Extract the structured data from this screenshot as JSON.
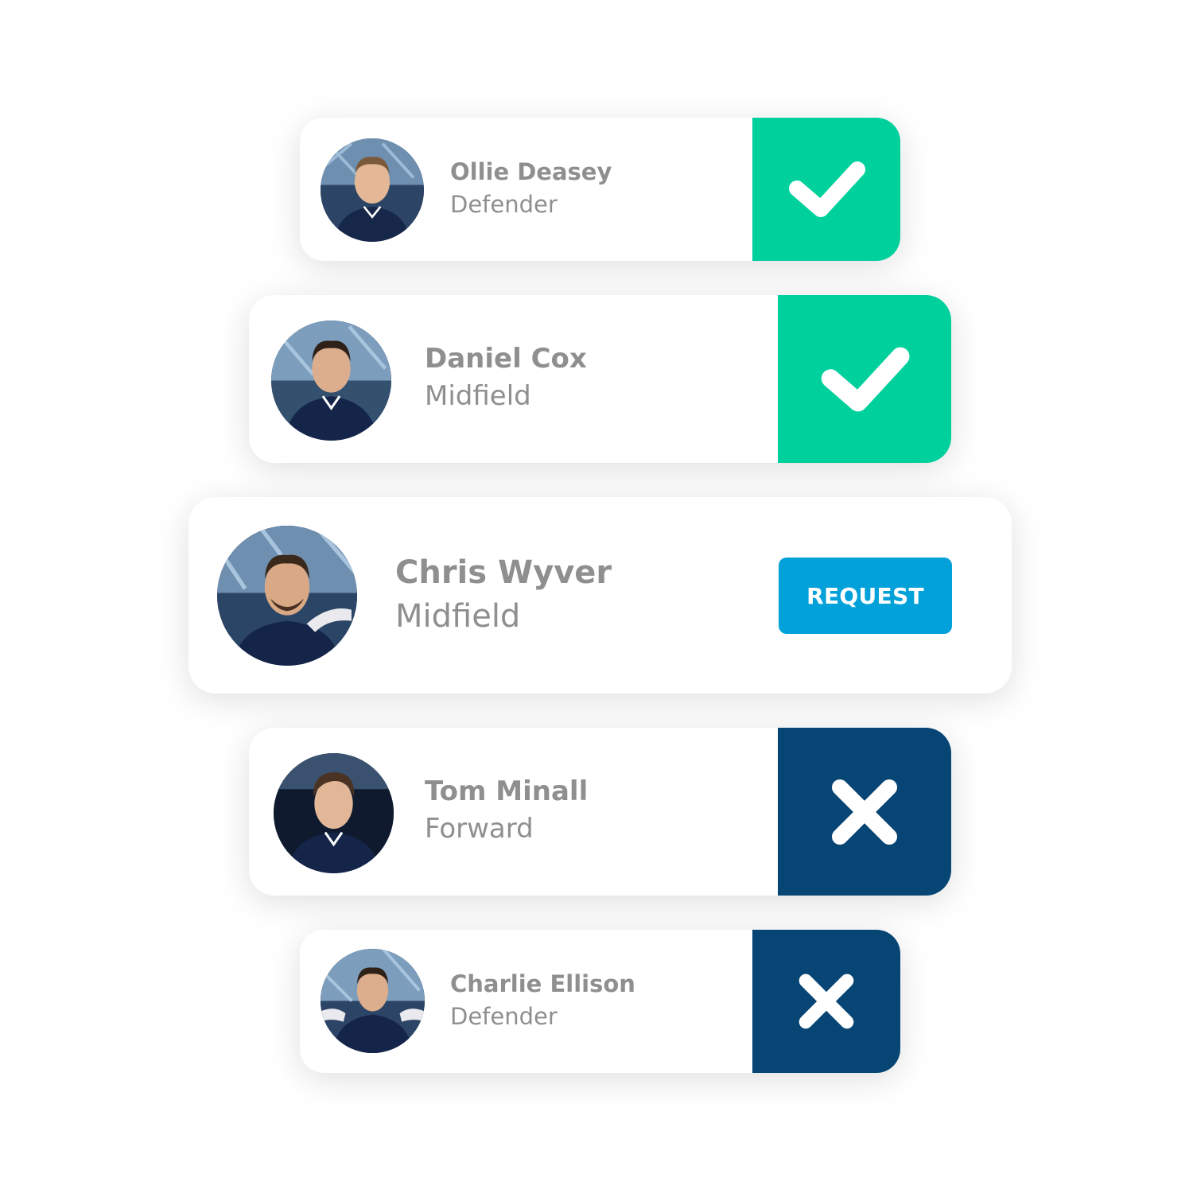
{
  "colors": {
    "accept": "#00d09c",
    "decline": "#074574",
    "request": "#03a1d9",
    "text": "#8f8f8f"
  },
  "players": [
    {
      "name": "Ollie Deasey",
      "position": "Defender",
      "status": "accepted",
      "action_icon": "check-icon"
    },
    {
      "name": "Daniel Cox",
      "position": "Midfield",
      "status": "accepted",
      "action_icon": "check-icon"
    },
    {
      "name": "Chris Wyver",
      "position": "Midfield",
      "status": "pending",
      "action_label": "REQUEST"
    },
    {
      "name": "Tom Minall",
      "position": "Forward",
      "status": "declined",
      "action_icon": "close-icon"
    },
    {
      "name": "Charlie Ellison",
      "position": "Defender",
      "status": "declined",
      "action_icon": "close-icon"
    }
  ]
}
